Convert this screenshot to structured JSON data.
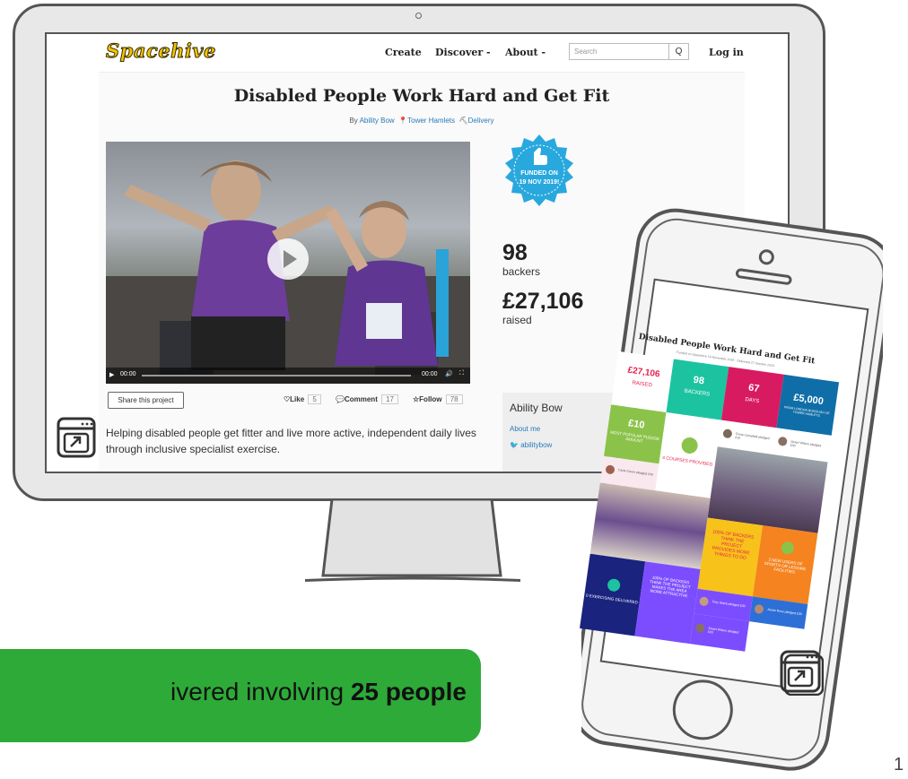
{
  "site": {
    "logo": "Spacehive",
    "nav": {
      "create": "Create",
      "discover": "Discover -",
      "about": "About -",
      "login": "Log in"
    },
    "search": {
      "placeholder": "Search",
      "button": "Q"
    },
    "title": "Disabled People Work Hard and Get Fit",
    "byline": {
      "by": "By",
      "author": "Ability Bow",
      "location": "Tower Hamlets",
      "stage": "Delivery"
    },
    "video": {
      "time_left": "00:00",
      "time_right": "00:00"
    },
    "share_label": "Share this project",
    "like_label": "Like",
    "like_count": "5",
    "comment_label": "Comment",
    "comment_count": "17",
    "follow_label": "Follow",
    "follow_count": "78",
    "description": "Helping disabled people get fitter and live more active, independent daily lives through inclusive specialist exercise.",
    "badge_line1": "FUNDED ON",
    "badge_line2": "19 NOV 2019!",
    "backers_value": "98",
    "backers_label": "backers",
    "raised_value": "£27,106",
    "raised_label": "raised",
    "owner": {
      "name": "Ability Bow",
      "about": "About me",
      "twitter": "abilitybow"
    }
  },
  "phone": {
    "title": "Disabled People Work Hard and Get Fit",
    "subtitle": "Funded on Spacehive 19 November 2019 · Delivered 27 October 2020",
    "tiles": {
      "raised_value": "£27,106",
      "raised_label": "RAISED",
      "backers_value": "98",
      "backers_label": "BACKERS",
      "days_value": "67",
      "days_label": "DAYS",
      "grant_value": "£5,000",
      "grant_label": "FROM LONDON BOROUGH OF TOWER HAMLETS",
      "pledge_value": "£10",
      "pledge_label": "MOST POPULAR PLEDGE AMOUNT",
      "courses_label": "4 COURSES PROVIDED",
      "pledger1": "Fiona Campbell pledged £10",
      "pledger2": "Stuart Wilson pledged £30",
      "pledger3": "Carla Green pledged £30",
      "percent_label": "100% OF BACKERS THINK THE PROJECT PROVIDES MORE THINGS TO DO",
      "users_label": "2 NEW USERS OF SPORTS OR LEISURE FACILITIES",
      "exercising_label": "0 EXERCISING DELIVERED",
      "attractive_label": "100% OF BACKERS THINK THE PROJECT MAKES THE AREA MORE ATTRACTIVE",
      "pledger4": "Tony Stack pledged £30",
      "pledger5": "Jessie Ross pledged £30",
      "pledger6": "Stuart Wilson pledged £30"
    }
  },
  "banner": {
    "prefix": "ivered involving ",
    "highlight": "25 people"
  },
  "page_number": "1",
  "colors": {
    "green": "#2eaa38",
    "badge": "#29a8de",
    "link": "#2a7ab8",
    "logo": "#f5c400"
  }
}
